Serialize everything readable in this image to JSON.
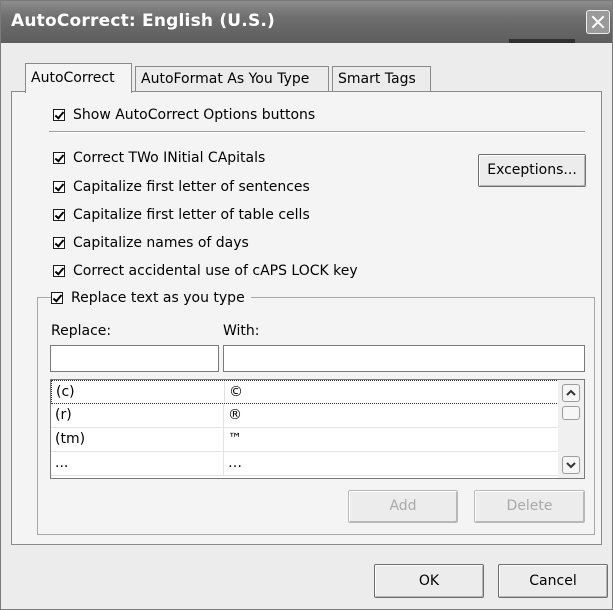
{
  "window": {
    "title": "AutoCorrect: English (U.S.)"
  },
  "tabs": [
    {
      "label": "AutoCorrect",
      "active": true
    },
    {
      "label": "AutoFormat As You Type",
      "active": false
    },
    {
      "label": "Smart Tags",
      "active": false
    }
  ],
  "options": {
    "show_buttons": {
      "label": "Show AutoCorrect Options buttons",
      "checked": true
    },
    "correct_two_initial": {
      "label": "Correct TWo INitial CApitals",
      "checked": true
    },
    "cap_sentences": {
      "label": "Capitalize first letter of sentences",
      "checked": true
    },
    "cap_table_cells": {
      "label": "Capitalize first letter of table cells",
      "checked": true
    },
    "cap_days": {
      "label": "Capitalize names of days",
      "checked": true
    },
    "caps_lock": {
      "label": "Correct accidental use of cAPS LOCK key",
      "checked": true
    },
    "replace_as_type": {
      "label": "Replace text as you type",
      "checked": true
    }
  },
  "exceptions_label": "Exceptions...",
  "replace": {
    "replace_label": "Replace:",
    "with_label": "With:",
    "replace_value": "",
    "with_value": "",
    "entries": [
      {
        "replace": "(c)",
        "with": "©"
      },
      {
        "replace": "(r)",
        "with": "®"
      },
      {
        "replace": "(tm)",
        "with": "™"
      },
      {
        "replace": "...",
        "with": "…"
      }
    ],
    "add_label": "Add",
    "delete_label": "Delete"
  },
  "footer": {
    "ok_label": "OK",
    "cancel_label": "Cancel"
  }
}
